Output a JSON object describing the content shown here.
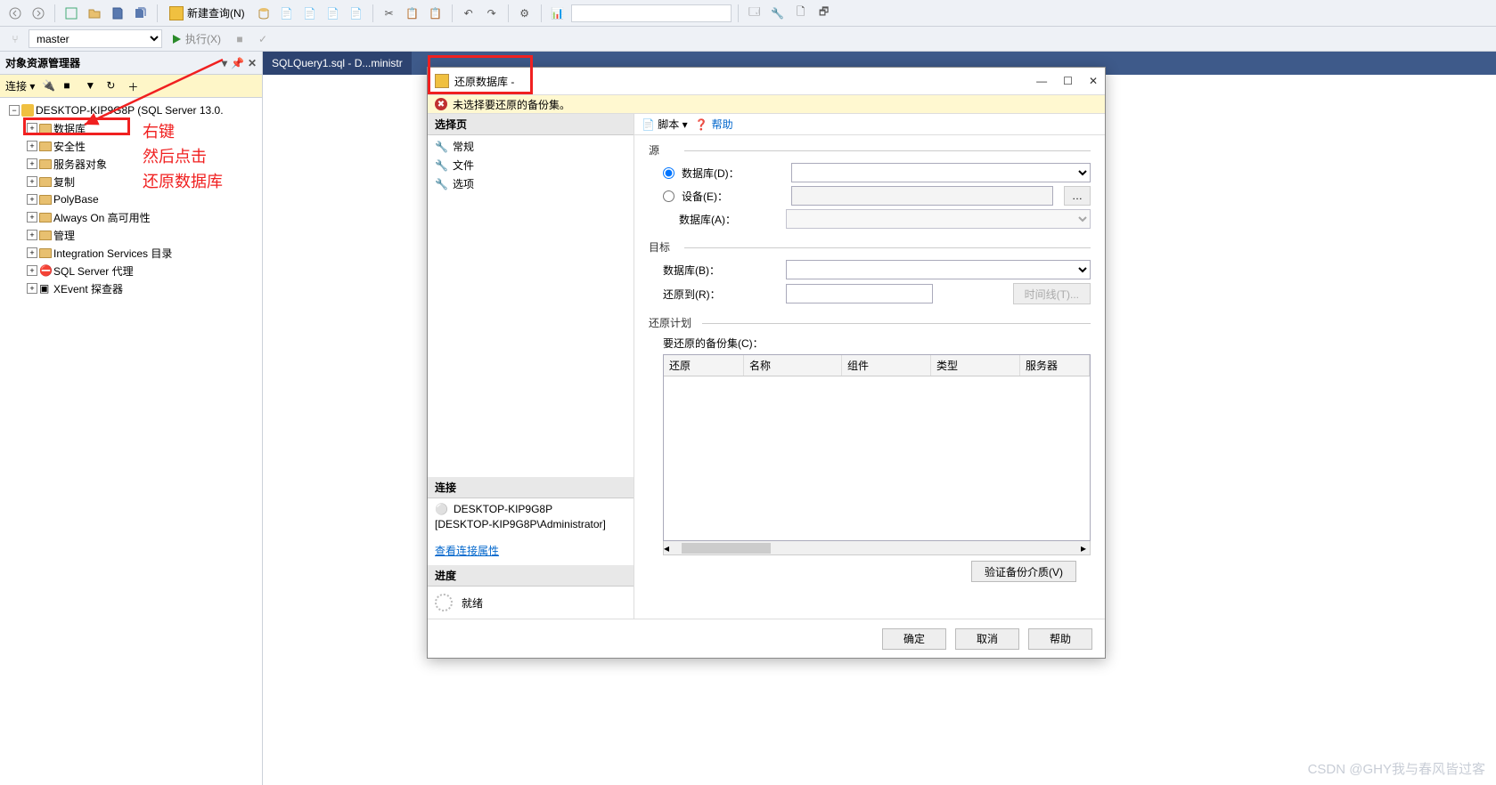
{
  "toolbar": {
    "new_query": "新建查询(N)",
    "master": "master",
    "execute": "执行(X)"
  },
  "sidebar": {
    "title": "对象资源管理器",
    "connect": "连接 ▾",
    "server": "DESKTOP-KIP9G8P (SQL Server 13.0.",
    "items": [
      "数据库",
      "安全性",
      "服务器对象",
      "复制",
      "PolyBase",
      "Always On 高可用性",
      "管理",
      "Integration Services 目录",
      "SQL Server 代理",
      "XEvent 探查器"
    ]
  },
  "annotations": {
    "a1": "右键",
    "a2": "然后点击",
    "a3": "还原数据库"
  },
  "editor": {
    "tab": "SQLQuery1.sql - D...ministr"
  },
  "dialog": {
    "title": "还原数据库 -",
    "warn": "未选择要还原的备份集。",
    "pages_header": "选择页",
    "pages": [
      "常规",
      "文件",
      "选项"
    ],
    "conn_header": "连接",
    "conn1": "DESKTOP-KIP9G8P",
    "conn2": "[DESKTOP-KIP9G8P\\Administrator]",
    "conn_link": "查看连接属性",
    "progress_header": "进度",
    "progress_status": "就绪",
    "right_tb_script": "脚本 ▾",
    "right_tb_help": "帮助",
    "src_legend": "源",
    "src_db": "数据库(D)：",
    "src_dev": "设备(E)：",
    "src_devdb": "数据库(A)：",
    "dst_legend": "目标",
    "dst_db": "数据库(B)：",
    "dst_to": "还原到(R)：",
    "timeline": "时间线(T)...",
    "plan_legend": "还原计划",
    "plan_sets": "要还原的备份集(C)：",
    "cols": [
      "还原",
      "名称",
      "组件",
      "类型",
      "服务器"
    ],
    "verify": "验证备份介质(V)",
    "ok": "确定",
    "cancel": "取消",
    "help": "帮助"
  },
  "watermark": "CSDN @GHY我与春风皆过客"
}
